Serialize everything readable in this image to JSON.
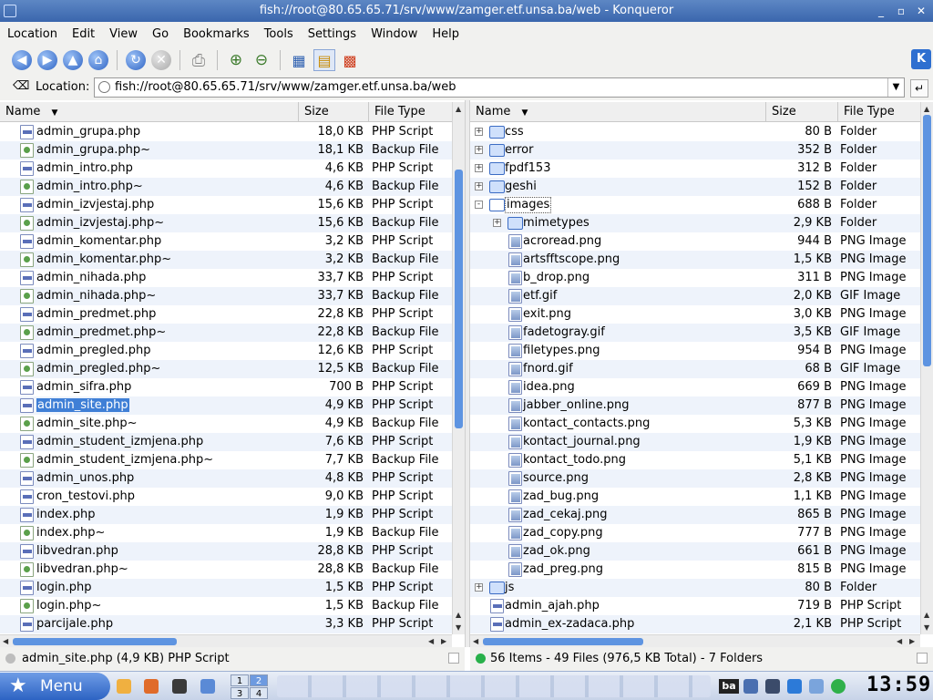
{
  "window": {
    "title": "fish://root@80.65.65.71/srv/www/zamger.etf.unsa.ba/web - Konqueror"
  },
  "menubar": {
    "items": [
      "Location",
      "Edit",
      "View",
      "Go",
      "Bookmarks",
      "Tools",
      "Settings",
      "Window",
      "Help"
    ]
  },
  "toolbar": {
    "icons": [
      "back-icon",
      "forward-icon",
      "up-icon",
      "home-icon",
      "reload-icon",
      "stop-icon",
      "print-icon",
      "zoom-in-icon",
      "zoom-out-icon",
      "icon-view-icon",
      "tree-view-icon",
      "multi-view-icon"
    ]
  },
  "location": {
    "label": "Location:",
    "value": "fish://root@80.65.65.71/srv/www/zamger.etf.unsa.ba/web"
  },
  "left_panel": {
    "columns": {
      "name": "Name",
      "size": "Size",
      "type": "File Type"
    },
    "rows": [
      {
        "name": "admin_grupa.php",
        "size": "18,0 KB",
        "type": "PHP Script",
        "icon": "php"
      },
      {
        "name": "admin_grupa.php~",
        "size": "18,1 KB",
        "type": "Backup File",
        "icon": "backup"
      },
      {
        "name": "admin_intro.php",
        "size": "4,6 KB",
        "type": "PHP Script",
        "icon": "php"
      },
      {
        "name": "admin_intro.php~",
        "size": "4,6 KB",
        "type": "Backup File",
        "icon": "backup"
      },
      {
        "name": "admin_izvjestaj.php",
        "size": "15,6 KB",
        "type": "PHP Script",
        "icon": "php"
      },
      {
        "name": "admin_izvjestaj.php~",
        "size": "15,6 KB",
        "type": "Backup File",
        "icon": "backup"
      },
      {
        "name": "admin_komentar.php",
        "size": "3,2 KB",
        "type": "PHP Script",
        "icon": "php"
      },
      {
        "name": "admin_komentar.php~",
        "size": "3,2 KB",
        "type": "Backup File",
        "icon": "backup"
      },
      {
        "name": "admin_nihada.php",
        "size": "33,7 KB",
        "type": "PHP Script",
        "icon": "php"
      },
      {
        "name": "admin_nihada.php~",
        "size": "33,7 KB",
        "type": "Backup File",
        "icon": "backup"
      },
      {
        "name": "admin_predmet.php",
        "size": "22,8 KB",
        "type": "PHP Script",
        "icon": "php"
      },
      {
        "name": "admin_predmet.php~",
        "size": "22,8 KB",
        "type": "Backup File",
        "icon": "backup"
      },
      {
        "name": "admin_pregled.php",
        "size": "12,6 KB",
        "type": "PHP Script",
        "icon": "php"
      },
      {
        "name": "admin_pregled.php~",
        "size": "12,5 KB",
        "type": "Backup File",
        "icon": "backup"
      },
      {
        "name": "admin_sifra.php",
        "size": "700 B",
        "type": "PHP Script",
        "icon": "php"
      },
      {
        "name": "admin_site.php",
        "size": "4,9 KB",
        "type": "PHP Script",
        "icon": "php",
        "selected": true
      },
      {
        "name": "admin_site.php~",
        "size": "4,9 KB",
        "type": "Backup File",
        "icon": "backup"
      },
      {
        "name": "admin_student_izmjena.php",
        "size": "7,6 KB",
        "type": "PHP Script",
        "icon": "php"
      },
      {
        "name": "admin_student_izmjena.php~",
        "size": "7,7 KB",
        "type": "Backup File",
        "icon": "backup"
      },
      {
        "name": "admin_unos.php",
        "size": "4,8 KB",
        "type": "PHP Script",
        "icon": "php"
      },
      {
        "name": "cron_testovi.php",
        "size": "9,0 KB",
        "type": "PHP Script",
        "icon": "php"
      },
      {
        "name": "index.php",
        "size": "1,9 KB",
        "type": "PHP Script",
        "icon": "php"
      },
      {
        "name": "index.php~",
        "size": "1,9 KB",
        "type": "Backup File",
        "icon": "backup"
      },
      {
        "name": "libvedran.php",
        "size": "28,8 KB",
        "type": "PHP Script",
        "icon": "php"
      },
      {
        "name": "libvedran.php~",
        "size": "28,8 KB",
        "type": "Backup File",
        "icon": "backup"
      },
      {
        "name": "login.php",
        "size": "1,5 KB",
        "type": "PHP Script",
        "icon": "php"
      },
      {
        "name": "login.php~",
        "size": "1,5 KB",
        "type": "Backup File",
        "icon": "backup"
      },
      {
        "name": "parcijale.php",
        "size": "3,3 KB",
        "type": "PHP Script",
        "icon": "php"
      }
    ]
  },
  "right_panel": {
    "columns": {
      "name": "Name",
      "size": "Size",
      "type": "File Type"
    },
    "rows": [
      {
        "name": "css",
        "size": "80 B",
        "type": "Folder",
        "icon": "folder",
        "level": 0,
        "expander": "+"
      },
      {
        "name": "error",
        "size": "352 B",
        "type": "Folder",
        "icon": "folder",
        "level": 0,
        "expander": "+"
      },
      {
        "name": "fpdf153",
        "size": "312 B",
        "type": "Folder",
        "icon": "folder",
        "level": 0,
        "expander": "+"
      },
      {
        "name": "geshi",
        "size": "152 B",
        "type": "Folder",
        "icon": "folder",
        "level": 0,
        "expander": "+"
      },
      {
        "name": "images",
        "size": "688 B",
        "type": "Folder",
        "icon": "folder-open",
        "level": 0,
        "expander": "-"
      },
      {
        "name": "mimetypes",
        "size": "2,9 KB",
        "type": "Folder",
        "icon": "folder",
        "level": 1,
        "expander": "+"
      },
      {
        "name": "acroread.png",
        "size": "944 B",
        "type": "PNG Image",
        "icon": "img",
        "level": 1
      },
      {
        "name": "artsfftscope.png",
        "size": "1,5 KB",
        "type": "PNG Image",
        "icon": "img",
        "level": 1
      },
      {
        "name": "b_drop.png",
        "size": "311 B",
        "type": "PNG Image",
        "icon": "img",
        "level": 1
      },
      {
        "name": "etf.gif",
        "size": "2,0 KB",
        "type": "GIF Image",
        "icon": "img",
        "level": 1
      },
      {
        "name": "exit.png",
        "size": "3,0 KB",
        "type": "PNG Image",
        "icon": "img",
        "level": 1
      },
      {
        "name": "fadetogray.gif",
        "size": "3,5 KB",
        "type": "GIF Image",
        "icon": "img",
        "level": 1
      },
      {
        "name": "filetypes.png",
        "size": "954 B",
        "type": "PNG Image",
        "icon": "img",
        "level": 1
      },
      {
        "name": "fnord.gif",
        "size": "68 B",
        "type": "GIF Image",
        "icon": "img",
        "level": 1
      },
      {
        "name": "idea.png",
        "size": "669 B",
        "type": "PNG Image",
        "icon": "img",
        "level": 1
      },
      {
        "name": "jabber_online.png",
        "size": "877 B",
        "type": "PNG Image",
        "icon": "img",
        "level": 1
      },
      {
        "name": "kontact_contacts.png",
        "size": "5,3 KB",
        "type": "PNG Image",
        "icon": "img",
        "level": 1
      },
      {
        "name": "kontact_journal.png",
        "size": "1,9 KB",
        "type": "PNG Image",
        "icon": "img",
        "level": 1
      },
      {
        "name": "kontact_todo.png",
        "size": "5,1 KB",
        "type": "PNG Image",
        "icon": "img",
        "level": 1
      },
      {
        "name": "source.png",
        "size": "2,8 KB",
        "type": "PNG Image",
        "icon": "img",
        "level": 1
      },
      {
        "name": "zad_bug.png",
        "size": "1,1 KB",
        "type": "PNG Image",
        "icon": "img",
        "level": 1
      },
      {
        "name": "zad_cekaj.png",
        "size": "865 B",
        "type": "PNG Image",
        "icon": "img",
        "level": 1
      },
      {
        "name": "zad_copy.png",
        "size": "777 B",
        "type": "PNG Image",
        "icon": "img",
        "level": 1
      },
      {
        "name": "zad_ok.png",
        "size": "661 B",
        "type": "PNG Image",
        "icon": "img",
        "level": 1
      },
      {
        "name": "zad_preg.png",
        "size": "815 B",
        "type": "PNG Image",
        "icon": "img",
        "level": 1
      },
      {
        "name": "js",
        "size": "80 B",
        "type": "Folder",
        "icon": "folder",
        "level": 0,
        "expander": "+"
      },
      {
        "name": "admin_ajah.php",
        "size": "719 B",
        "type": "PHP Script",
        "icon": "php",
        "level": 0
      },
      {
        "name": "admin_ex-zadaca.php",
        "size": "2,1 KB",
        "type": "PHP Script",
        "icon": "php",
        "level": 0
      }
    ]
  },
  "status": {
    "left": "admin_site.php (4,9 KB)  PHP Script",
    "right": "56 Items - 49 Files (976,5 KB Total) - 7 Folders"
  },
  "taskbar": {
    "menu_label": "Menu",
    "desktops": [
      "1",
      "2",
      "3",
      "4"
    ],
    "tray_text": "ba",
    "clock": "13:59"
  },
  "colors": {
    "selection": "#3f7fd6",
    "titlebar": "#3a66ad",
    "scroll_thumb": "#5e94e1"
  }
}
